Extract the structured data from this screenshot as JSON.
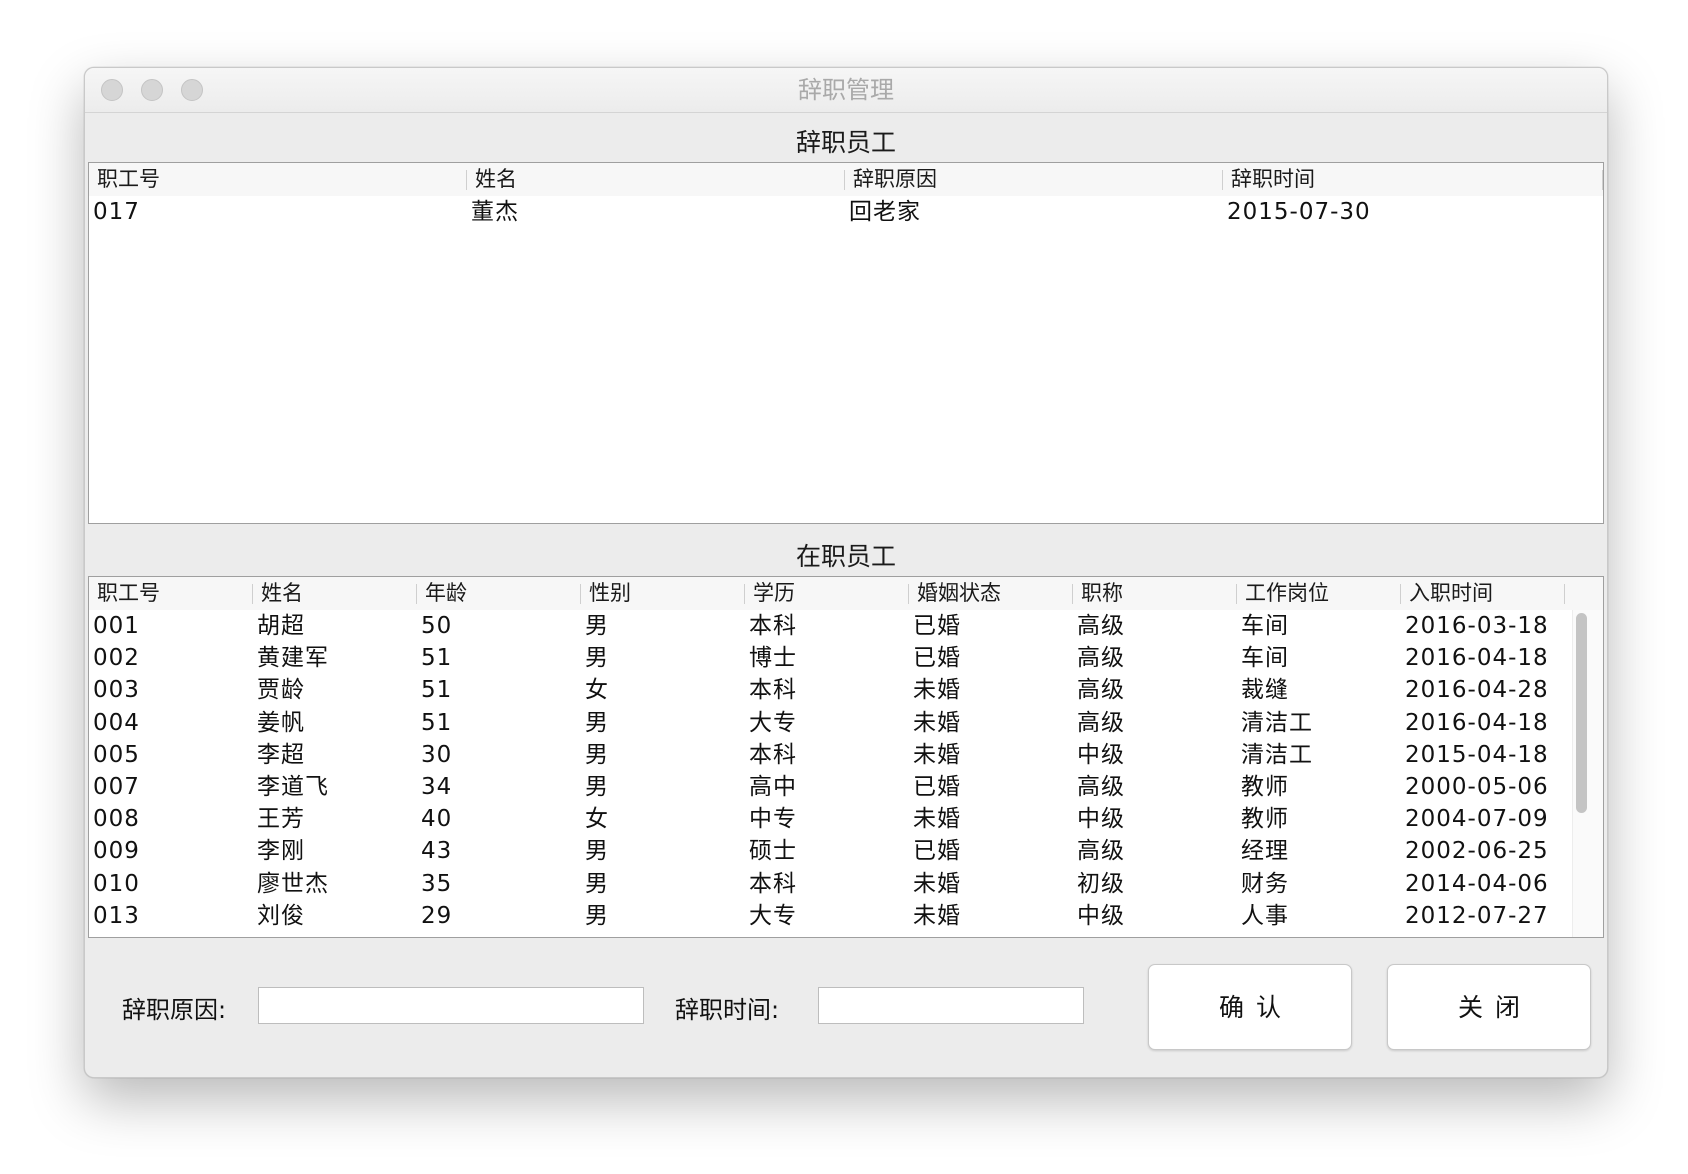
{
  "window": {
    "title": "辞职管理"
  },
  "resigned_section": {
    "title": "辞职员工",
    "columns": [
      "职工号",
      "姓名",
      "辞职原因",
      "辞职时间"
    ],
    "rows": [
      [
        "017",
        "董杰",
        "回老家",
        "2015-07-30"
      ]
    ]
  },
  "active_section": {
    "title": "在职员工",
    "columns": [
      "职工号",
      "姓名",
      "年龄",
      "性别",
      "学历",
      "婚姻状态",
      "职称",
      "工作岗位",
      "入职时间"
    ],
    "rows": [
      [
        "001",
        "胡超",
        "50",
        "男",
        "本科",
        "已婚",
        "高级",
        "车间",
        "2016-03-18"
      ],
      [
        "002",
        "黄建军",
        "51",
        "男",
        "博士",
        "已婚",
        "高级",
        "车间",
        "2016-04-18"
      ],
      [
        "003",
        "贾龄",
        "51",
        "女",
        "本科",
        "未婚",
        "高级",
        "裁缝",
        "2016-04-28"
      ],
      [
        "004",
        "姜帆",
        "51",
        "男",
        "大专",
        "未婚",
        "高级",
        "清洁工",
        "2016-04-18"
      ],
      [
        "005",
        "李超",
        "30",
        "男",
        "本科",
        "未婚",
        "中级",
        "清洁工",
        "2015-04-18"
      ],
      [
        "007",
        "李道飞",
        "34",
        "男",
        "高中",
        "已婚",
        "高级",
        "教师",
        "2000-05-06"
      ],
      [
        "008",
        "王芳",
        "40",
        "女",
        "中专",
        "未婚",
        "中级",
        "教师",
        "2004-07-09"
      ],
      [
        "009",
        "李刚",
        "43",
        "男",
        "硕士",
        "已婚",
        "高级",
        "经理",
        "2002-06-25"
      ],
      [
        "010",
        "廖世杰",
        "35",
        "男",
        "本科",
        "未婚",
        "初级",
        "财务",
        "2014-04-06"
      ],
      [
        "013",
        "刘俊",
        "29",
        "男",
        "大专",
        "未婚",
        "中级",
        "人事",
        "2012-07-27"
      ]
    ]
  },
  "form": {
    "reason_label": "辞职原因:",
    "reason_value": "",
    "date_label": "辞职时间:",
    "date_value": "",
    "confirm_label": "确认",
    "close_label": "关闭"
  }
}
